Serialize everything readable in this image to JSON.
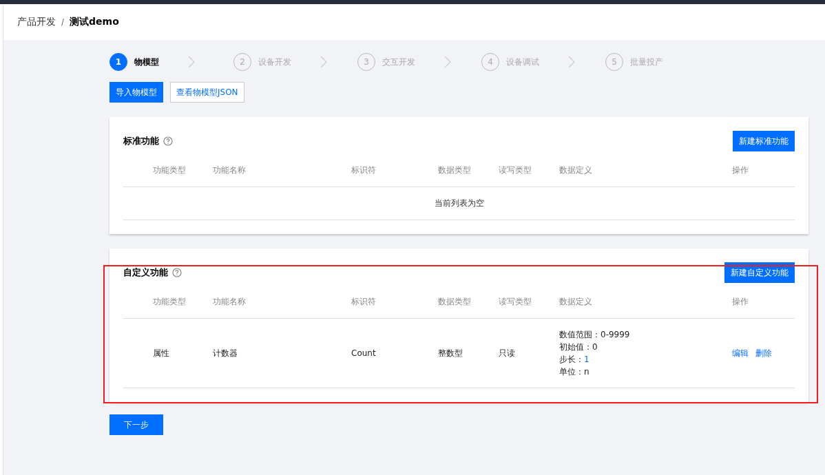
{
  "breadcrumb": [
    {
      "label": "产品开发",
      "selected": false
    },
    {
      "label": "测试demo",
      "selected": true
    }
  ],
  "breadcrumb_separator": "/",
  "steps": [
    {
      "number": "1",
      "label": "物模型",
      "selected": true
    },
    {
      "number": "2",
      "label": "设备开发",
      "selected": false
    },
    {
      "number": "3",
      "label": "交互开发",
      "selected": false
    },
    {
      "number": "4",
      "label": "设备调试",
      "selected": false
    },
    {
      "number": "5",
      "label": "批量投产",
      "selected": false
    }
  ],
  "toolbar": [
    {
      "label": "导入物模型",
      "kind": "primary"
    },
    {
      "label": "查看物模型JSON",
      "kind": "outline"
    }
  ],
  "sections": [
    {
      "title": "标准功能",
      "button": "新建标准功能",
      "highlighted": false,
      "columns": [
        "功能类型",
        "功能名称",
        "标识符",
        "数据类型",
        "读写类型",
        "数据定义",
        "操作"
      ],
      "empty_text": "当前列表为空"
    },
    {
      "title": "自定义功能",
      "button": "新建自定义功能",
      "highlighted": true,
      "columns": [
        "功能类型",
        "功能名称",
        "标识符",
        "数据类型",
        "读写类型",
        "数据定义",
        "操作"
      ],
      "rows": [
        {
          "type": "属性",
          "name": "计数器",
          "identifier": "Count",
          "data_type": "整数型",
          "access": "只读",
          "definition": [
            {
              "label": "数值范围：",
              "value": "0-9999",
              "kind": "plain"
            },
            {
              "label": "初始值：",
              "value": "0",
              "kind": "plain"
            },
            {
              "label": "步长：",
              "value": "1",
              "kind": "accent"
            },
            {
              "label": "单位：",
              "value": "n",
              "kind": "plain"
            }
          ],
          "actions": [
            "编辑",
            "删除"
          ]
        }
      ]
    }
  ],
  "next_button": "下一步"
}
